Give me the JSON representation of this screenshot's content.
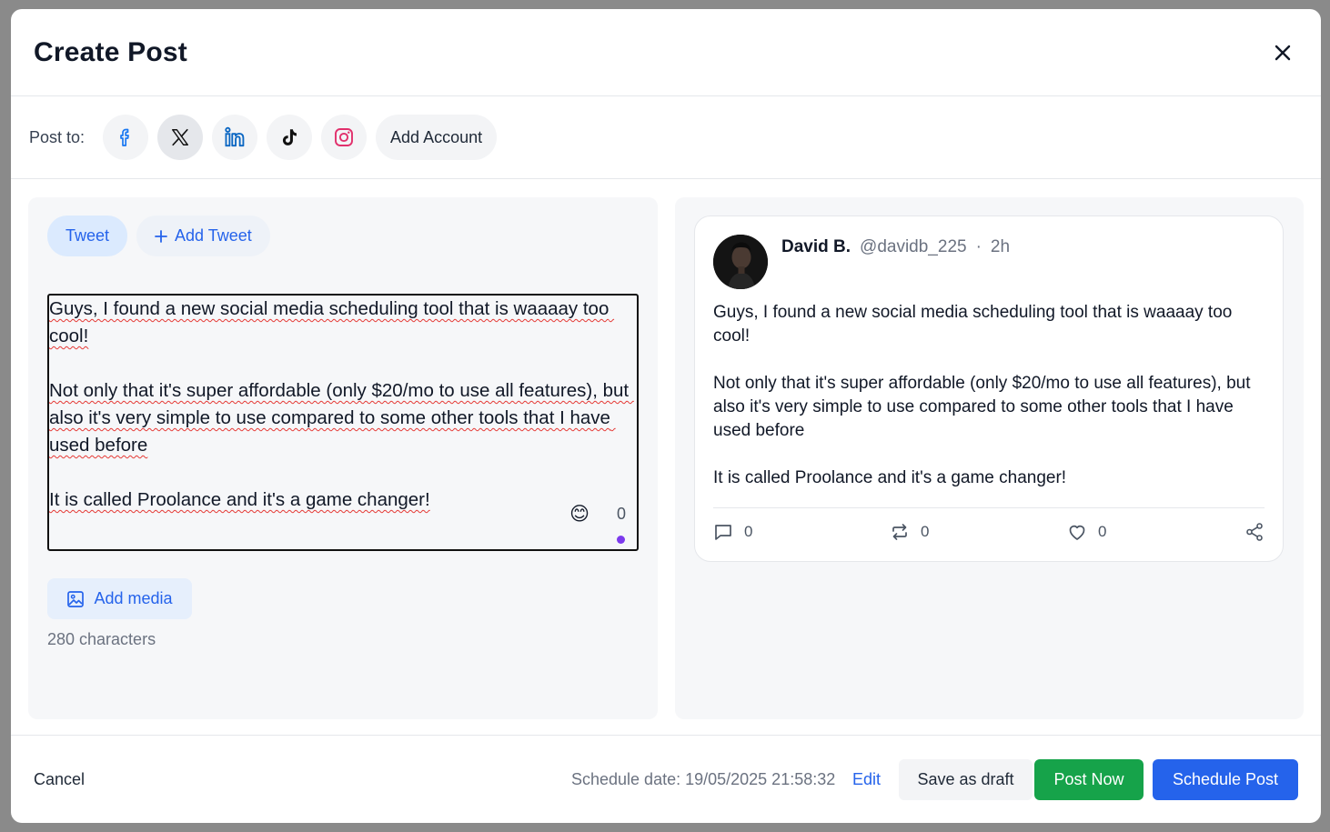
{
  "modal": {
    "title": "Create Post"
  },
  "post_to": {
    "label": "Post to:",
    "accounts": [
      {
        "name": "facebook",
        "icon": "facebook-icon",
        "color": "#1877f2",
        "selected": false
      },
      {
        "name": "x",
        "icon": "x-icon",
        "color": "#111111",
        "selected": true
      },
      {
        "name": "linkedin",
        "icon": "linkedin-icon",
        "color": "#0a66c2",
        "selected": false
      },
      {
        "name": "tiktok",
        "icon": "tiktok-icon",
        "color": "#111111",
        "selected": false
      },
      {
        "name": "instagram",
        "icon": "instagram-icon",
        "color": "#e1306c",
        "selected": false
      }
    ],
    "add_account_label": "Add Account"
  },
  "editor": {
    "tabs": {
      "tweet": "Tweet",
      "add_tweet": "Add Tweet"
    },
    "text": "Guys, I found a new social media scheduling tool that is waaaay too cool!\n\nNot only that it's super affordable (only $20/mo to use all features), but also it's very simple to use compared to some other tools that I have used before\n\nIt is called Proolance and it's a game changer!",
    "emoji_icon": "😊",
    "char_count": "0",
    "add_media_label": "Add media",
    "limit_note": "280 characters"
  },
  "preview": {
    "author": "David B.",
    "handle": "@davidb_225",
    "separator": "·",
    "time": "2h",
    "text": "Guys, I found a new social media scheduling tool that is waaaay too cool!\n\nNot only that it's super affordable (only $20/mo to use all features), but also it's very simple to use compared to some other tools that I have used before\n\nIt is called Proolance and it's a game changer!",
    "replies": "0",
    "retweets": "0",
    "likes": "0"
  },
  "footer": {
    "cancel_label": "Cancel",
    "schedule_text": "Schedule date: 19/05/2025 21:58:32",
    "edit_label": "Edit",
    "save_draft_label": "Save as draft",
    "post_now_label": "Post Now",
    "schedule_label": "Schedule Post"
  },
  "colors": {
    "primary": "#2563eb",
    "success": "#16a34a",
    "accent_dot": "#7c3aed"
  }
}
